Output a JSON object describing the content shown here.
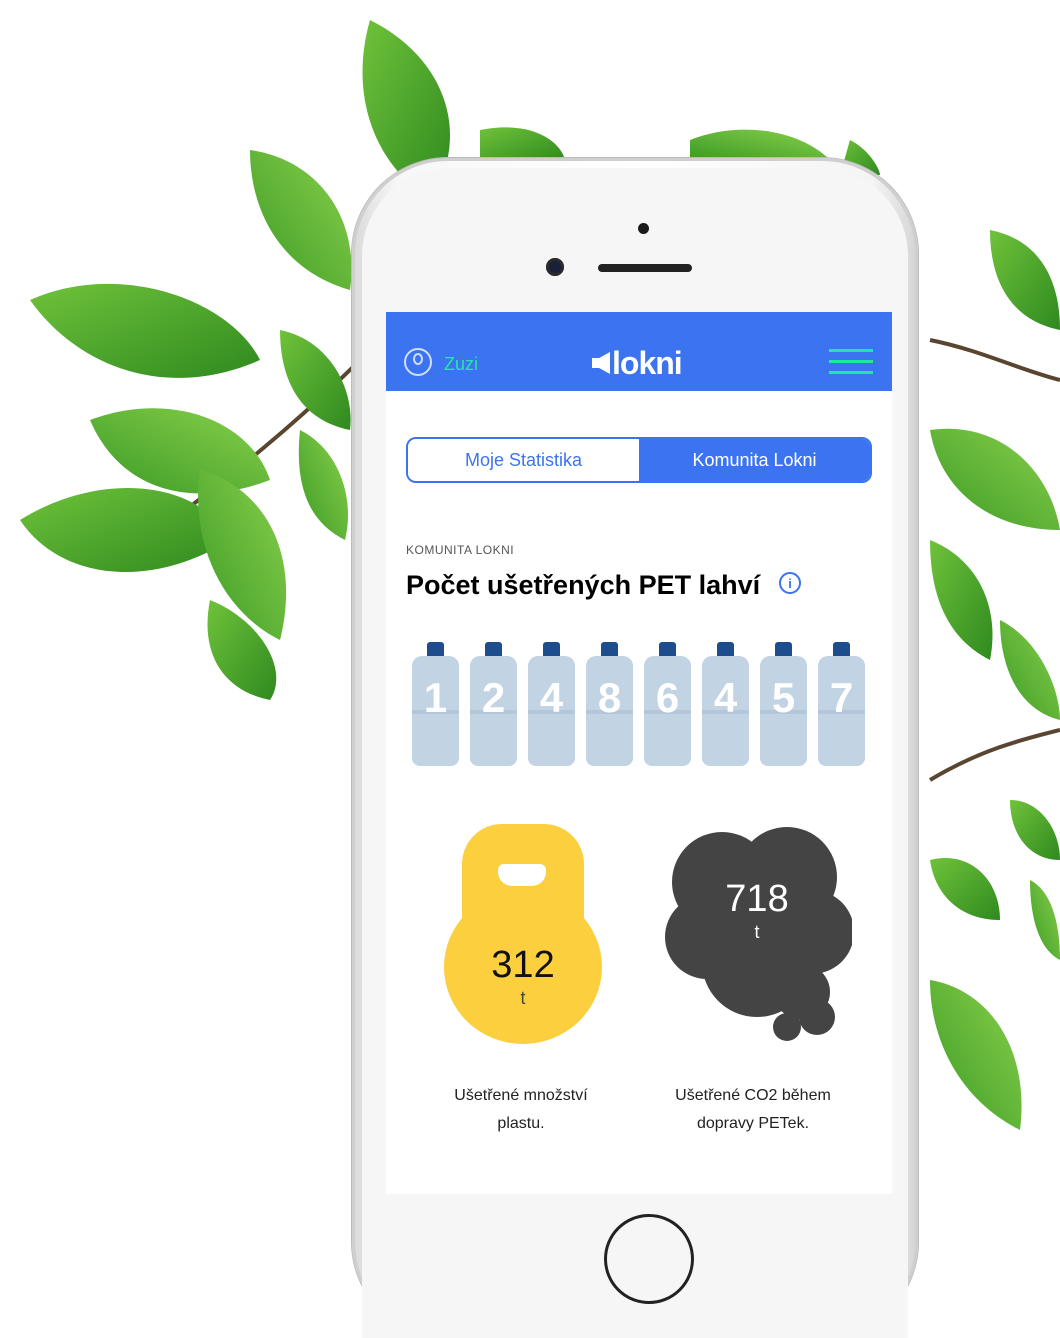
{
  "header": {
    "user_name": "Zuzi",
    "logo_text": "lokni"
  },
  "tabs": [
    {
      "label": "Moje Statistika",
      "active": false
    },
    {
      "label": "Komunita Lokni",
      "active": true
    }
  ],
  "section": {
    "label": "KOMUNITA LOKNI",
    "title": "Počet ušetřených PET lahví"
  },
  "bottle_counter": [
    "1",
    "2",
    "4",
    "8",
    "6",
    "4",
    "5",
    "7"
  ],
  "stats": {
    "plastic": {
      "value": "312",
      "unit": "t",
      "caption_line1": "Ušetřené množství",
      "caption_line2": "plastu."
    },
    "co2": {
      "value": "718",
      "unit": "t",
      "caption_line1": "Ušetřené CO2 během",
      "caption_line2": "dopravy PETek."
    }
  },
  "colors": {
    "brand_blue": "#3c73f0",
    "accent_green": "#29e7a2",
    "plastic_yellow": "#fbcf3d",
    "co2_gray": "#444444",
    "bottle": "#c2d3e4",
    "bottle_cap": "#1d4d8c"
  },
  "icons": {
    "user": "user-icon",
    "menu": "hamburger-menu-icon",
    "info": "info-icon"
  }
}
